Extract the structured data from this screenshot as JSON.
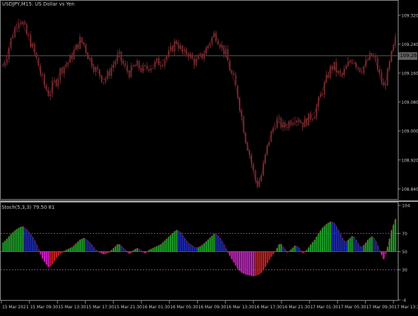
{
  "main_title": "USDJPY,M15:  US Dollar vs Yen",
  "osc_title": "Stoch(5,3,3) 79.50 81",
  "current_price": "109.262",
  "colors": {
    "background": "#000000",
    "frame": "#8c8c8c",
    "price_line": "#606060",
    "candle": "#6b2a2a",
    "ribbon": "#b41e3c",
    "level_lines": "#8a4a8a",
    "hist_green": "#1e9e28",
    "hist_blue": "#1e2aa0",
    "hist_red": "#c81e1e",
    "hist_magenta": "#c81ec8",
    "axis_text": "#c8c8c8"
  },
  "price_axis_labels": [
    "109.320",
    "109.240",
    "109.160",
    "109.080",
    "109.000",
    "108.920",
    "108.840"
  ],
  "osc_axis_labels": [
    "104",
    "70",
    "50",
    "30",
    "-4"
  ],
  "time_labels": [
    "15 Mar 2021",
    "15 Mar 09:30",
    "15 Mar 13:30",
    "15 Mar 17:30",
    "15 Mar 21:30",
    "16 Mar 01:30",
    "16 Mar 05:30",
    "16 Mar 09:30",
    "16 Mar 13:30",
    "16 Mar 17:30",
    "16 Mar 21:30",
    "17 Mar 01:30",
    "17 Mar 05:30",
    "17 Mar 09:30",
    "17 Mar 13:30"
  ],
  "chart_data": [
    {
      "type": "candlestick",
      "title": "USDJPY,M15:  US Dollar vs Yen",
      "ylim": [
        108.81,
        109.36
      ],
      "y_ticks": [
        109.32,
        109.24,
        109.16,
        109.08,
        109.0,
        108.92,
        108.84
      ],
      "current_price": 109.262,
      "close": [
        109.18,
        109.21,
        109.25,
        109.28,
        109.31,
        109.3,
        109.27,
        109.25,
        109.22,
        109.19,
        109.15,
        109.12,
        109.1,
        109.13,
        109.14,
        109.17,
        109.18,
        109.19,
        109.21,
        109.23,
        109.25,
        109.24,
        109.21,
        109.19,
        109.17,
        109.16,
        109.14,
        109.15,
        109.17,
        109.19,
        109.21,
        109.19,
        109.17,
        109.16,
        109.18,
        109.18,
        109.17,
        109.17,
        109.18,
        109.18,
        109.19,
        109.19,
        109.2,
        109.21,
        109.23,
        109.25,
        109.23,
        109.21,
        109.22,
        109.2,
        109.19,
        109.2,
        109.21,
        109.23,
        109.25,
        109.27,
        109.25,
        109.23,
        109.21,
        109.17,
        109.14,
        109.1,
        109.04,
        108.98,
        108.94,
        108.89,
        108.85,
        108.87,
        108.92,
        108.97,
        109.0,
        109.03,
        109.02,
        109.01,
        109.02,
        109.03,
        109.04,
        109.03,
        109.02,
        109.03,
        109.04,
        109.05,
        109.08,
        109.11,
        109.14,
        109.17,
        109.18,
        109.16,
        109.15,
        109.17,
        109.19,
        109.2,
        109.18,
        109.17,
        109.18,
        109.2,
        109.21,
        109.19,
        109.15,
        109.12,
        109.16,
        109.21,
        109.25
      ]
    },
    {
      "type": "bar",
      "title": "Stoch(5,3,3) 79.50 81",
      "ylim": [
        -4,
        104
      ],
      "levels": [
        70,
        50,
        30
      ],
      "values": [
        60,
        64,
        69,
        73,
        76,
        78,
        75,
        70,
        64,
        55,
        44,
        37,
        32,
        38,
        44,
        48,
        51,
        53,
        55,
        59,
        63,
        65,
        62,
        58,
        52,
        50,
        47,
        48,
        51,
        55,
        59,
        55,
        51,
        47,
        52,
        54,
        51,
        48,
        52,
        54,
        56,
        58,
        62,
        66,
        70,
        74,
        72,
        66,
        60,
        57,
        54,
        55,
        58,
        62,
        66,
        70,
        67,
        61,
        53,
        45,
        38,
        31,
        27,
        25,
        24,
        23,
        24,
        26,
        32,
        40,
        46,
        52,
        60,
        54,
        49,
        53,
        57,
        54,
        48,
        52,
        58,
        63,
        70,
        76,
        80,
        83,
        82,
        75,
        66,
        60,
        64,
        68,
        61,
        54,
        58,
        64,
        67,
        61,
        50,
        41,
        56,
        74,
        86
      ]
    }
  ]
}
